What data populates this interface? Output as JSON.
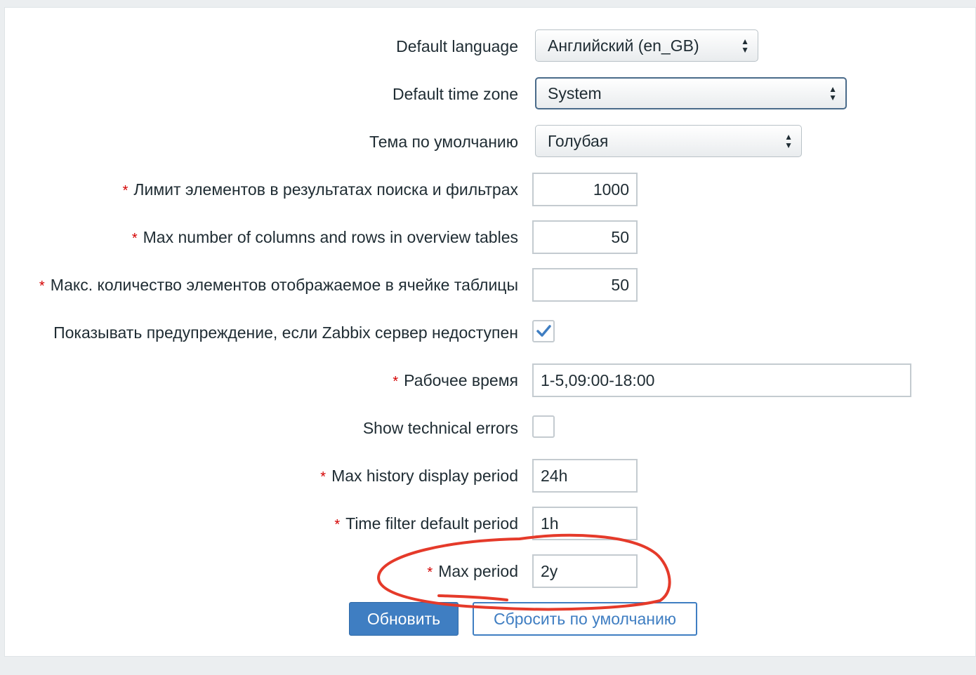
{
  "form": {
    "default_language": {
      "label": "Default language",
      "value": "Английский (en_GB)"
    },
    "default_time_zone": {
      "label": "Default time zone",
      "value": "System"
    },
    "default_theme": {
      "label": "Тема по умолчанию",
      "value": "Голубая"
    },
    "search_limit": {
      "required_mark": "*",
      "label": "Лимит элементов в результатах поиска и фильтрах",
      "value": "1000"
    },
    "overview_max": {
      "required_mark": "*",
      "label": "Max number of columns and rows in overview tables",
      "value": "50"
    },
    "table_cell_max": {
      "required_mark": "*",
      "label": "Макс. количество элементов отображаемое в ячейке таблицы",
      "value": "50"
    },
    "server_warning": {
      "label": "Показывать предупреждение, если Zabbix сервер недоступен",
      "checked": true
    },
    "work_period": {
      "required_mark": "*",
      "label": "Рабочее время",
      "value": "1-5,09:00-18:00"
    },
    "technical_errors": {
      "label": "Show technical errors",
      "checked": false
    },
    "history_period": {
      "required_mark": "*",
      "label": "Max history display period",
      "value": "24h"
    },
    "time_filter_period": {
      "required_mark": "*",
      "label": "Time filter default period",
      "value": "1h"
    },
    "max_period": {
      "required_mark": "*",
      "label": "Max period",
      "value": "2y"
    }
  },
  "buttons": {
    "update": "Обновить",
    "reset": "Сбросить по умолчанию"
  },
  "icons": {
    "select_arrows": "up-down-arrows-icon",
    "checkbox_check": "checkmark-icon"
  },
  "colors": {
    "primary": "#3f7ec2",
    "required": "#d40000",
    "annotation": "#e53a2a"
  }
}
